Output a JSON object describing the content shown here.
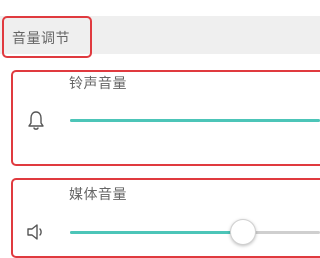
{
  "section": {
    "title": "音量调节"
  },
  "ringtone": {
    "label": "铃声音量",
    "icon": "bell-icon",
    "level_fraction": 1.0
  },
  "media": {
    "label": "媒体音量",
    "icon": "speaker-icon",
    "level_fraction": 0.69
  },
  "colors": {
    "accent": "#4cc5b8",
    "track_inactive": "#cfcfcf",
    "highlight_border": "#e03a3f",
    "header_bg": "#efefef",
    "text": "#666666"
  }
}
